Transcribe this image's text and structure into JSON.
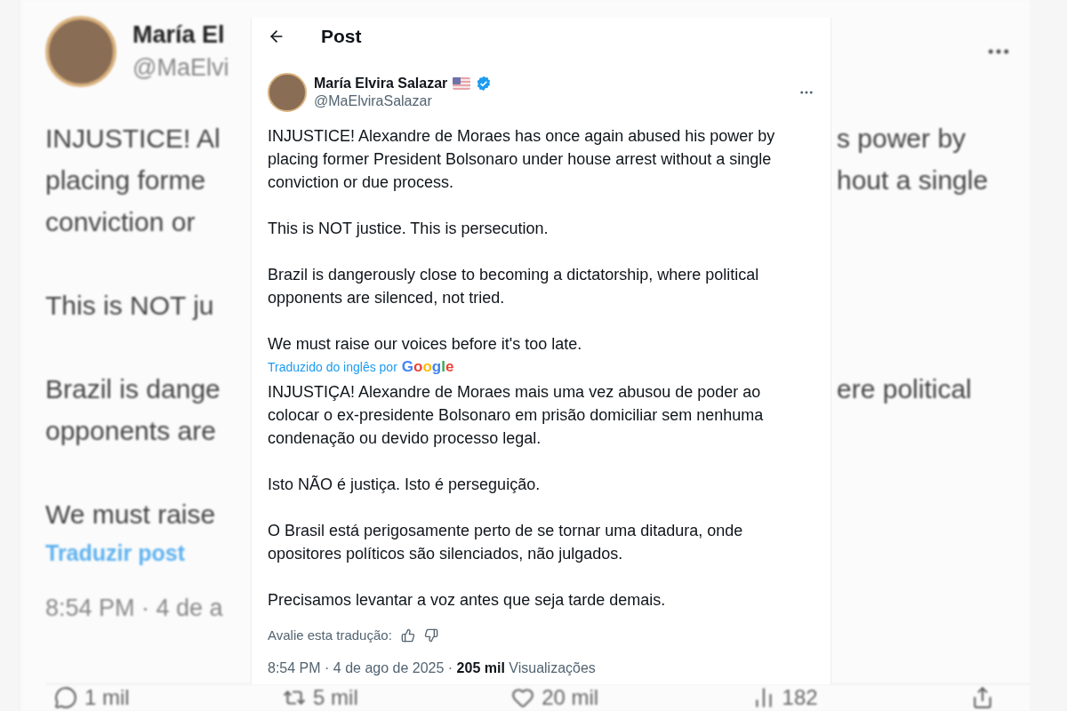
{
  "background_post": {
    "author_name": "María El",
    "handle": "@MaElvi",
    "paragraphs": [
      [
        {
          "left": "INJUSTICE! Al",
          "right": "s power by"
        },
        {
          "left": "placing forme",
          "right": "hout a single"
        },
        {
          "left": "conviction or"
        }
      ],
      [
        {
          "left": "This is NOT ju"
        }
      ],
      [
        {
          "left": "Brazil is dange",
          "right": "ere political"
        },
        {
          "left": "opponents are"
        }
      ],
      [
        {
          "left": "We must raise"
        }
      ]
    ],
    "translate_link": "Traduzir post",
    "timestamp": "8:54 PM · 4 de a",
    "actions": [
      {
        "kind": "reply",
        "count": "1 mil"
      },
      {
        "kind": "repost",
        "count": "5 mil"
      },
      {
        "kind": "like",
        "count": "20 mil"
      },
      {
        "kind": "views",
        "count": "182"
      },
      {
        "kind": "share"
      }
    ]
  },
  "header": {
    "title": "Post"
  },
  "post": {
    "author_name": "María Elvira Salazar",
    "handle": "@MaElviraSalazar",
    "verified": true,
    "paragraphs": [
      "INJUSTICE! Alexandre de Moraes has once again abused his power by placing former President Bolsonaro under house arrest without a single conviction or due process.",
      "This is NOT justice. This is persecution.",
      "Brazil is dangerously close to becoming a dictatorship, where political opponents are silenced, not tried.",
      "We must raise our voices before it's too late."
    ],
    "translation_credit": "Traduzido do inglês por",
    "translation_provider": "Google",
    "translated_paragraphs": [
      "INJUSTIÇA! Alexandre de Moraes mais uma vez abusou de poder ao colocar o ex-presidente Bolsonaro em prisão domiciliar sem nenhuma condenação ou devido processo legal.",
      "Isto NÃO é justiça. Isto é perseguição.",
      "O Brasil está perigosamente perto de se tornar uma ditadura, onde opositores políticos são silenciados, não julgados.",
      "Precisamos levantar a voz antes que seja tarde demais."
    ],
    "rate_label": "Avalie esta tradução:",
    "meta": "8:54 PM · 4 de ago de 2025 · **205 mil** Visualizações"
  }
}
